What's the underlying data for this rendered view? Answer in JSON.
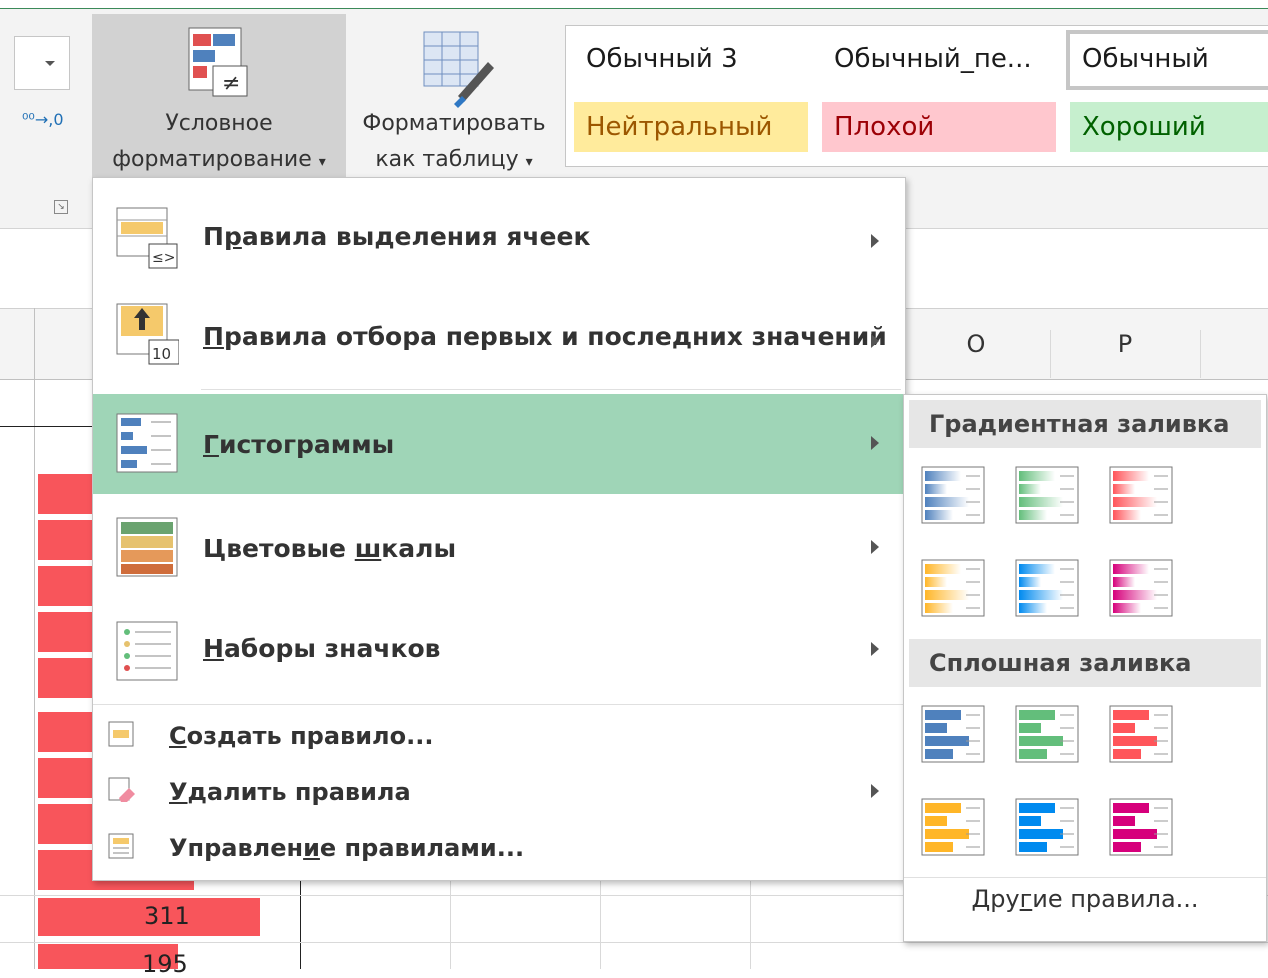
{
  "ribbon": {
    "number_format_dropdown": "",
    "decrease_decimal_icon": "⁰⁰→,0",
    "conditional_formatting": {
      "line1": "Условное",
      "line2": "форматирование"
    },
    "format_as_table": {
      "line1": "Форматировать",
      "line2": "как таблицу"
    },
    "styles": [
      {
        "label": "Обычный 3",
        "bg": "#ffffff"
      },
      {
        "label": "Обычный_пе...",
        "bg": "#ffffff"
      },
      {
        "label": "Обычный",
        "bg": "#ffffff"
      },
      {
        "label": "Нейтральный",
        "bg": "#ffeb9c",
        "color": "#9c5700"
      },
      {
        "label": "Плохой",
        "bg": "#ffc7ce",
        "color": "#9c0006"
      },
      {
        "label": "Хороший",
        "bg": "#c6efce",
        "color": "#006100"
      }
    ]
  },
  "sheet": {
    "columns": [
      "O",
      "P"
    ],
    "visible_values": [
      "311",
      "195"
    ]
  },
  "menu": {
    "items": [
      {
        "label_pre": "П",
        "label_u": "р",
        "label_post": "авила выделения ячеек"
      },
      {
        "label_pre": "",
        "label_u": "П",
        "label_post": "равила отбора первых и последних значений"
      },
      {
        "label_pre": "",
        "label_u": "Г",
        "label_post": "истограммы"
      },
      {
        "label_pre": "Цветовые ",
        "label_u": "ш",
        "label_post": "калы"
      },
      {
        "label_pre": "",
        "label_u": "Н",
        "label_post": "аборы значков"
      }
    ],
    "small_items": [
      {
        "label_pre": "",
        "label_u": "С",
        "label_post": "оздать правило..."
      },
      {
        "label_pre": "",
        "label_u": "У",
        "label_post": "далить правила"
      },
      {
        "label_pre": "Управлен",
        "label_u": "и",
        "label_post": "е правилами..."
      }
    ],
    "highlight_color": "#9fd5b7"
  },
  "submenu": {
    "gradient_header": "Градиентная заливка",
    "solid_header": "Сплошная заливка",
    "other_rules": {
      "pre": "Дру",
      "u": "г",
      "post": "ие правила..."
    },
    "colors": [
      "#4f81bd",
      "#63be7b",
      "#ff555a",
      "#ffb628",
      "#008aef",
      "#d6007b"
    ]
  }
}
